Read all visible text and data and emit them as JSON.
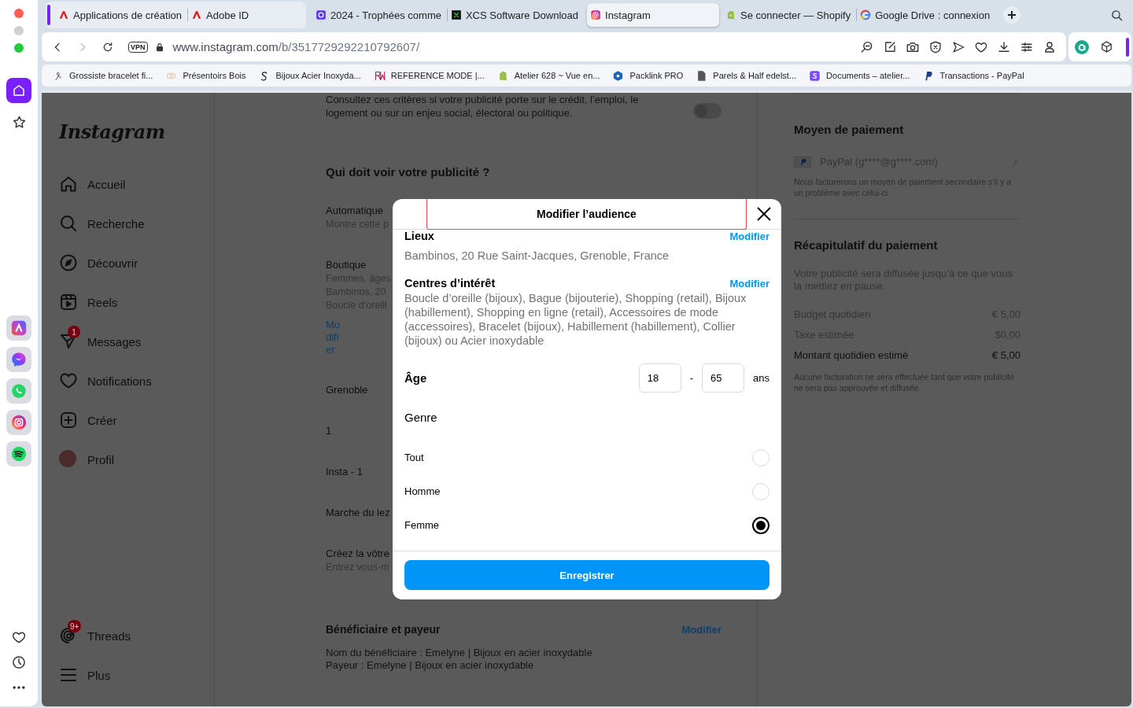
{
  "browser": {
    "tabs": [
      {
        "label": "Applications de création",
        "grouped": true,
        "selected": false
      },
      {
        "label": "Adobe ID",
        "grouped": true,
        "selected": false
      },
      {
        "label": "2024 - Trophées comme",
        "grouped": false,
        "selected": false
      },
      {
        "label": "XCS Software Download",
        "grouped": false,
        "selected": false
      },
      {
        "label": "Instagram",
        "grouped": false,
        "selected": true
      },
      {
        "label": "Se connecter — Shopify",
        "grouped": false,
        "selected": false
      },
      {
        "label": "Google Drive : connexion",
        "grouped": false,
        "selected": false
      }
    ],
    "forward_disabled": true,
    "vpn_label": "VPN",
    "url_host": "www.instagram.com",
    "url_path": "/b/3517729292210792607/",
    "bookmarks": [
      "Grossiste bracelet fi...",
      "Présentoirs Bois",
      "Bijoux Acier Inoxyda...",
      "REFERENCE MODE |...",
      "Atelier 628 ~ Vue en...",
      "Packlink PRO",
      "Parels & Half edelst...",
      "Documents – atelier...",
      "Transactions - PayPal"
    ]
  },
  "instagram_nav": {
    "logo": "Instagram",
    "items": [
      {
        "label": "Accueil"
      },
      {
        "label": "Recherche"
      },
      {
        "label": "Découvrir"
      },
      {
        "label": "Reels"
      },
      {
        "label": "Messages",
        "badge": "1"
      },
      {
        "label": "Notifications"
      },
      {
        "label": "Créer"
      },
      {
        "label": "Profil"
      }
    ],
    "bottom_items": [
      {
        "label": "Threads",
        "badge": "9+"
      },
      {
        "label": "Plus"
      }
    ]
  },
  "main": {
    "notice": "Consultez ces critères si votre publicité porte sur le crédit, l’emploi, le logement ou sur un enjeu social, électoral ou politique.",
    "toggle": {
      "on": false
    },
    "audience_heading": "Qui doit voir votre publicité ?",
    "options": [
      {
        "title": "Automatique",
        "details": [
          "Montre cette p"
        ]
      },
      {
        "title": "Boutique",
        "details": [
          "Femmes, âges",
          "Bambinos, 20",
          "Boucle d’oreill"
        ],
        "link": "Modifier"
      },
      {
        "title": "Grenoble"
      },
      {
        "title": "1"
      },
      {
        "title": "Insta - 1"
      },
      {
        "title": "Marche du lez"
      },
      {
        "title": "Créez la vôtre",
        "details": [
          "Entrez vous-m"
        ]
      }
    ],
    "beneficiary": {
      "heading": "Bénéficiaire et payeur",
      "link": "Modifier",
      "lines": [
        "Nom du bénéficiaire : Emelyne | Bijoux en acier inoxydable",
        "Payeur : Emelyne | Bijoux en acier inoxydable"
      ]
    }
  },
  "payment": {
    "method_heading": "Moyen de paiement",
    "method": "PayPal (g****@g****.com)",
    "method_note": "Nous facturerons un moyen de paiement secondaire s’il y a un problème avec celui-ci.",
    "summary_heading": "Récapitulatif du paiement",
    "summary_text": "Votre publicité sera diffusée jusqu’à ce que vous la mettiez en pause.",
    "rows": [
      {
        "label": "Budget quotidien",
        "value": "€ 5,00",
        "total": false
      },
      {
        "label": "Taxe estimée",
        "value": "$0,00",
        "total": false
      },
      {
        "label": "Montant quotidien estimé",
        "value": "€ 5,00",
        "total": true
      }
    ],
    "billing_note": "Aucune facturation ne sera effectuée tant que votre publicité ne sera pas approuvée et diffusée."
  },
  "modal": {
    "title": "Modifier l’audience",
    "sections": [
      {
        "heading": "Lieux",
        "link": "Modifier",
        "text": "Bambinos, 20 Rue Saint-Jacques, Grenoble, France"
      },
      {
        "heading": "Centres d’intérêt",
        "link": "Modifier",
        "text": "Boucle d’oreille (bijoux), Bague (bijouterie), Shopping (retail), Bijoux (habillement), Shopping en ligne (retail), Accessoires de mode (accessoires), Bracelet (bijoux), Habillement (habillement), Collier (bijoux) ou Acier inoxydable"
      }
    ],
    "age": {
      "label": "Âge",
      "min": "18",
      "separator": "-",
      "max": "65",
      "unit": "ans"
    },
    "gender": {
      "label": "Genre",
      "options": [
        {
          "label": "Tout",
          "selected": false
        },
        {
          "label": "Homme",
          "selected": false
        },
        {
          "label": "Femme",
          "selected": true
        }
      ]
    },
    "save_button": "Enregistrer"
  }
}
